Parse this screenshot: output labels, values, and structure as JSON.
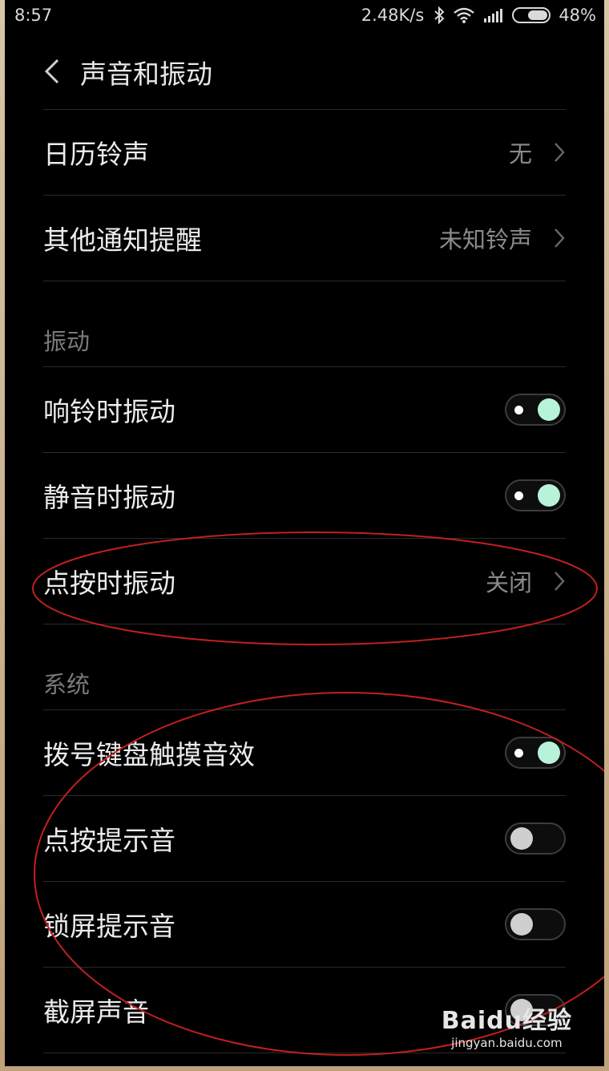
{
  "status_bar": {
    "time": "8:57",
    "net_speed": "2.48K/s",
    "battery": "48%",
    "icons": [
      "bluetooth-icon",
      "wifi-icon",
      "signal-icon",
      "battery-icon"
    ]
  },
  "header": {
    "title": "声音和振动",
    "back_icon": "chevron-left-icon"
  },
  "rows_top": [
    {
      "label": "日历铃声",
      "value": "无"
    },
    {
      "label": "其他通知提醒",
      "value": "未知铃声"
    }
  ],
  "section_vibration": {
    "title": "振动",
    "toggles": [
      {
        "label": "响铃时振动",
        "state": "on"
      },
      {
        "label": "静音时振动",
        "state": "on"
      }
    ],
    "nav": {
      "label": "点按时振动",
      "value": "关闭"
    }
  },
  "section_system": {
    "title": "系统",
    "toggles": [
      {
        "label": "拨号键盘触摸音效",
        "state": "on"
      },
      {
        "label": "点按提示音",
        "state": "off"
      },
      {
        "label": "锁屏提示音",
        "state": "off"
      },
      {
        "label": "截屏声音",
        "state": "off"
      }
    ]
  },
  "watermark": {
    "logo": "Baidu经验",
    "url": "jingyan.baidu.com"
  },
  "colors": {
    "background": "#000000",
    "toggle_on": "#b8f3d9",
    "toggle_off": "#cfcfcf",
    "annotation": "#c0201e"
  }
}
